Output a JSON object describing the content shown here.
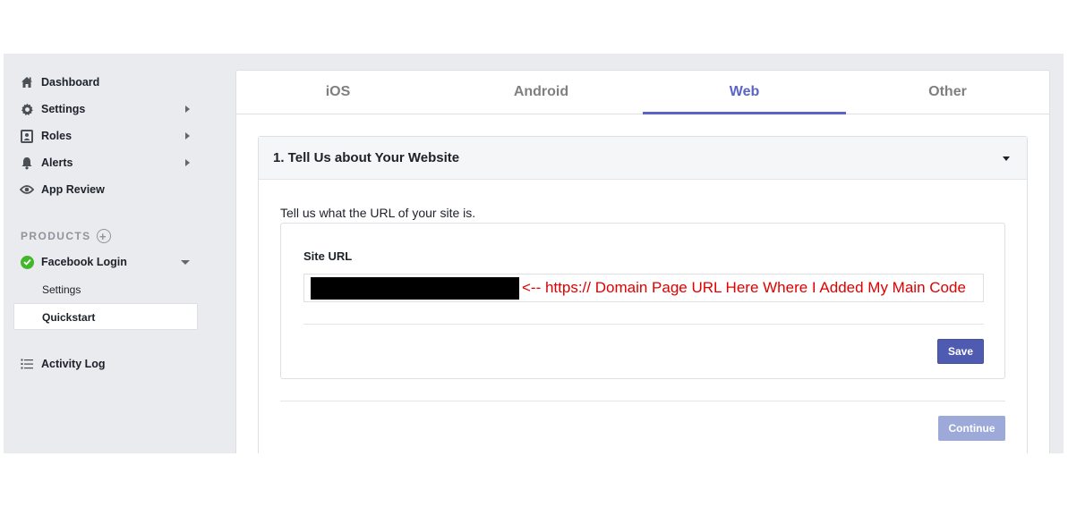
{
  "sidebar": {
    "items": [
      {
        "label": "Dashboard",
        "icon": "home-icon"
      },
      {
        "label": "Settings",
        "icon": "gear-icon"
      },
      {
        "label": "Roles",
        "icon": "roles-icon"
      },
      {
        "label": "Alerts",
        "icon": "bell-icon"
      },
      {
        "label": "App Review",
        "icon": "eye-icon"
      }
    ],
    "products_label": "PRODUCTS",
    "product": {
      "label": "Facebook Login",
      "icon": "check-circle-icon"
    },
    "sub_items": [
      "Settings",
      "Quickstart"
    ],
    "activity_log": {
      "label": "Activity Log",
      "icon": "list-icon"
    }
  },
  "tabs": [
    "iOS",
    "Android",
    "Web",
    "Other"
  ],
  "active_tab": "Web",
  "section": {
    "title": "1. Tell Us about Your Website",
    "prompt": "Tell us what the URL of your site is.",
    "field_label": "Site URL",
    "annotation": "<-- https:// Domain Page URL Here Where I Added My Main Code",
    "save_label": "Save",
    "continue_label": "Continue"
  },
  "colors": {
    "accent": "#5b63c6",
    "save": "#4f5bb0",
    "continue_disabled": "#9ca9d9",
    "annotation": "#e00000",
    "sidebar_bg": "#e9ebee"
  }
}
